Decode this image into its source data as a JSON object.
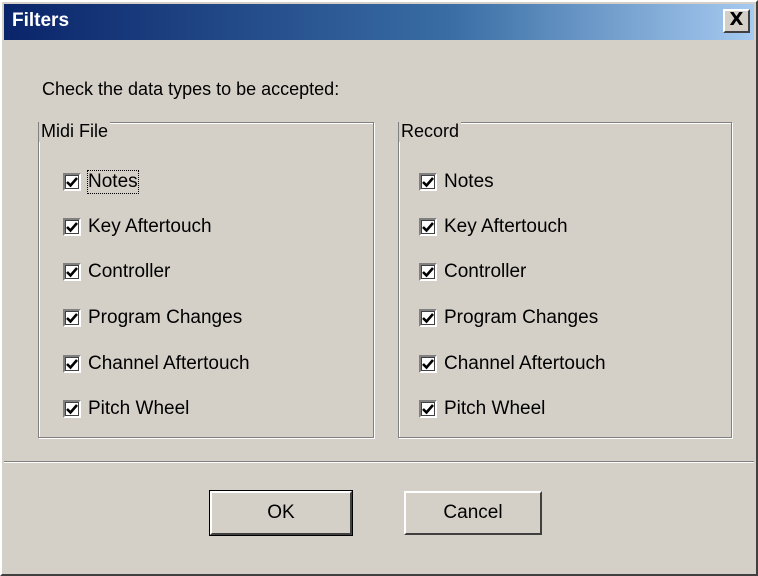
{
  "window": {
    "title": "Filters",
    "close_label": "X"
  },
  "instruction": "Check the data types to be accepted:",
  "midi_group": {
    "label": "Midi File",
    "items": [
      {
        "label": "Notes",
        "checked": true
      },
      {
        "label": "Key Aftertouch",
        "checked": true
      },
      {
        "label": "Controller",
        "checked": true
      },
      {
        "label": "Program Changes",
        "checked": true
      },
      {
        "label": "Channel Aftertouch",
        "checked": true
      },
      {
        "label": "Pitch Wheel",
        "checked": true
      }
    ]
  },
  "record_group": {
    "label": "Record",
    "items": [
      {
        "label": "Notes",
        "checked": true
      },
      {
        "label": "Key Aftertouch",
        "checked": true
      },
      {
        "label": "Controller",
        "checked": true
      },
      {
        "label": "Program Changes",
        "checked": true
      },
      {
        "label": "Channel Aftertouch",
        "checked": true
      },
      {
        "label": "Pitch Wheel",
        "checked": true
      }
    ]
  },
  "buttons": {
    "ok": "OK",
    "cancel": "Cancel"
  }
}
